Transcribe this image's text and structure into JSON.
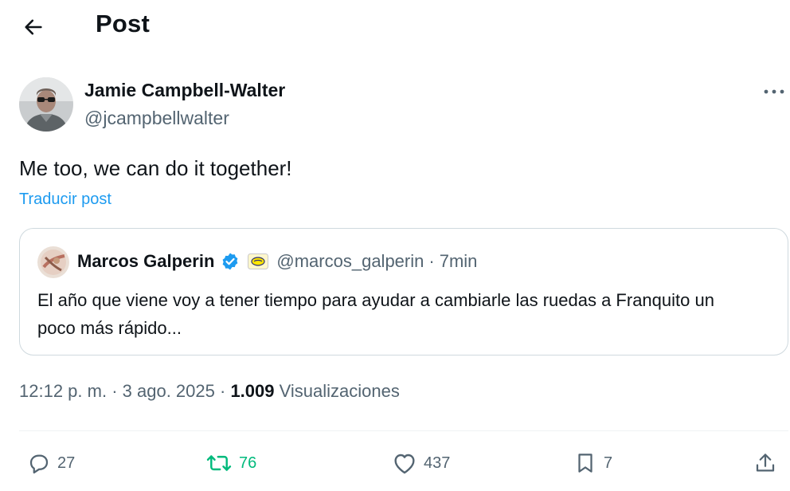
{
  "header": {
    "title": "Post"
  },
  "post": {
    "author_name": "Jamie Campbell-Walter",
    "author_handle": "@jcampbellwalter",
    "text": "Me too, we can do it together!",
    "translate_label": "Traducir post"
  },
  "quote": {
    "author_name": "Marcos Galperin",
    "author_handle": "@marcos_galperin",
    "separator": "·",
    "time": "7min",
    "text": "El año que viene voy a tener tiempo para ayudar a cambiarle las ruedas a Franquito un poco más rápido..."
  },
  "meta": {
    "time": "12:12 p. m.",
    "sep1": " · ",
    "date": "3 ago. 2025",
    "sep2": " · ",
    "views_count": "1.009",
    "views_label": " Visualizaciones"
  },
  "actions": {
    "replies": "27",
    "reposts": "76",
    "likes": "437",
    "bookmarks": "7"
  },
  "colors": {
    "accent": "#1d9bf0",
    "repost_active": "#00ba7c",
    "secondary_text": "#536471",
    "border": "#cfd9de"
  },
  "icons": {
    "back": "arrow-left-icon",
    "more": "more-horizontal-icon",
    "verified": "verified-badge-icon",
    "reply": "speech-bubble-icon",
    "repost": "repost-icon",
    "like": "heart-icon",
    "bookmark": "bookmark-icon",
    "share": "share-icon"
  }
}
